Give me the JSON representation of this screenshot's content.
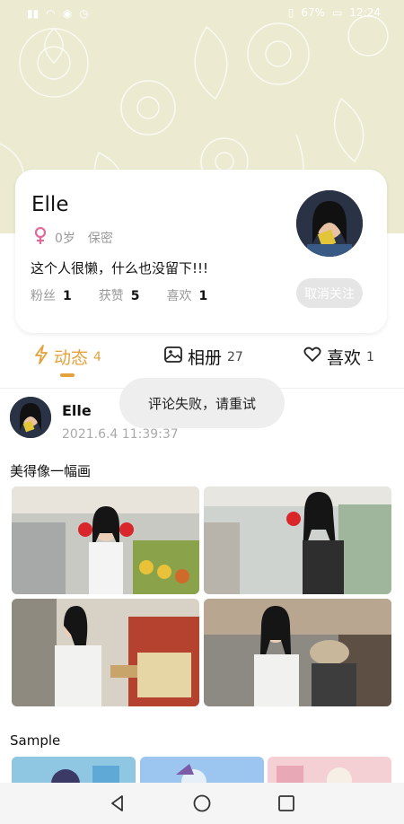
{
  "status_bar": {
    "battery": "67%",
    "time": "12:24"
  },
  "profile": {
    "name": "Elle",
    "age": "0岁",
    "privacy": "保密",
    "bio": "这个人很懒，什么也没留下!!!",
    "stats": [
      {
        "label": "粉丝",
        "value": "1"
      },
      {
        "label": "获赞",
        "value": "5"
      },
      {
        "label": "喜欢",
        "value": "1"
      }
    ],
    "unfollow_label": "取消关注"
  },
  "tabs": [
    {
      "label": "动态",
      "count": "4",
      "active": true
    },
    {
      "label": "相册",
      "count": "27",
      "active": false
    },
    {
      "label": "喜欢",
      "count": "1",
      "active": false
    }
  ],
  "post": {
    "author": "Elle",
    "time": "2021.6.4 11:39:37",
    "title": "美得像一幅画"
  },
  "toast": "评论失败，请重试",
  "section2": {
    "title": "Sample"
  },
  "colors": {
    "accent": "#e5a13b",
    "hero_bg": "#ecebd2",
    "button_gray": "#e5e5e5"
  }
}
